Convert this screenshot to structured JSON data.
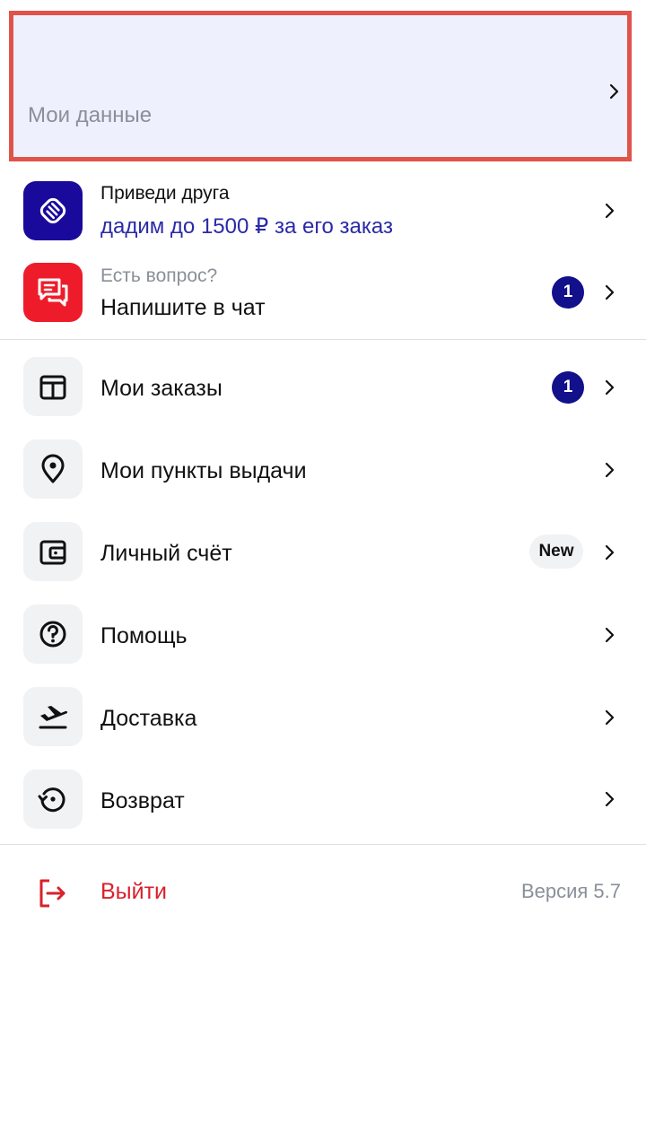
{
  "profile": {
    "name": "",
    "label": "Мои данные"
  },
  "referral": {
    "title": "Приведи друга",
    "subtitle": "дадим до 1500 ₽ за его заказ"
  },
  "support": {
    "title": "Есть вопрос?",
    "subtitle": "Напишите в чат",
    "badge": "1"
  },
  "menu": {
    "items": [
      {
        "label": "Мои заказы",
        "icon": "box-icon",
        "badge": "1"
      },
      {
        "label": "Мои пункты выдачи",
        "icon": "location-pin-icon"
      },
      {
        "label": "Личный счёт",
        "icon": "wallet-icon",
        "tag": "New"
      },
      {
        "label": "Помощь",
        "icon": "question-circle-icon"
      },
      {
        "label": "Доставка",
        "icon": "plane-departure-icon"
      },
      {
        "label": "Возврат",
        "icon": "history-icon"
      }
    ]
  },
  "footer": {
    "logout": "Выйти",
    "version": "Версия 5.7"
  },
  "colors": {
    "accent_blue": "#2b2aa7",
    "badge_navy": "#12108a",
    "logout_red": "#d9202c",
    "highlight_border": "#e0534a"
  }
}
